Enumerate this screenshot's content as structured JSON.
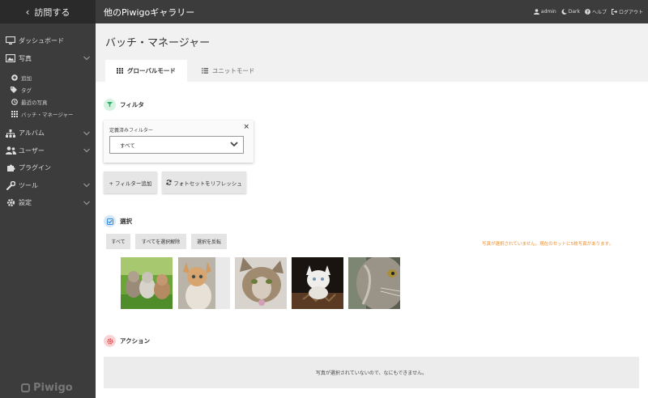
{
  "sidebar": {
    "visit_label": "訪問する",
    "menu": [
      {
        "label": "ダッシュボード",
        "icon": "monitor-icon"
      },
      {
        "label": "写真",
        "icon": "photo-icon"
      }
    ],
    "submenu": [
      {
        "label": "追加",
        "icon": "plus-circle-icon"
      },
      {
        "label": "タグ",
        "icon": "tags-icon"
      },
      {
        "label": "最近の写真",
        "icon": "clock-icon"
      },
      {
        "label": "バッチ・マネージャー",
        "icon": "grid-icon"
      }
    ],
    "menu2": [
      {
        "label": "アルバム",
        "icon": "sitemap-icon"
      },
      {
        "label": "ユーザー",
        "icon": "users-icon"
      },
      {
        "label": "プラグイン",
        "icon": "puzzle-icon"
      },
      {
        "label": "ツール",
        "icon": "wrench-icon"
      },
      {
        "label": "設定",
        "icon": "gear-icon"
      }
    ],
    "logo": "Piwigo"
  },
  "topbar": {
    "gallery_title": "他のPiwigoギャラリー",
    "links": {
      "admin": "admin",
      "dark": "Dark",
      "help": "ヘルプ",
      "logout": "ログアウト"
    }
  },
  "page": {
    "title": "バッチ・マネージャー",
    "tabs": {
      "global": "グローバルモード",
      "unit": "ユニットモード"
    }
  },
  "filter": {
    "title": "フィルタ",
    "box_label": "定義済みフィルター",
    "select_value": "すべて",
    "add_button": "+ フィルター追加",
    "refresh_button": "フォトセットをリフレッシュ"
  },
  "selection": {
    "title": "選択",
    "all": "すべて",
    "none": "すべてを選択解除",
    "invert": "選択を反転",
    "status": "写真が選択されていません。現在のセットに5枚写真があります。"
  },
  "actions": {
    "title": "アクション",
    "empty_message": "写真が選択されていないので、なにもできません。"
  },
  "colors": {
    "sidebar_bg": "#3c3c3c",
    "status_orange": "#f28b22",
    "filter_green": "#2fb36b",
    "select_blue": "#3a8fd6",
    "action_red": "#e0484c"
  }
}
